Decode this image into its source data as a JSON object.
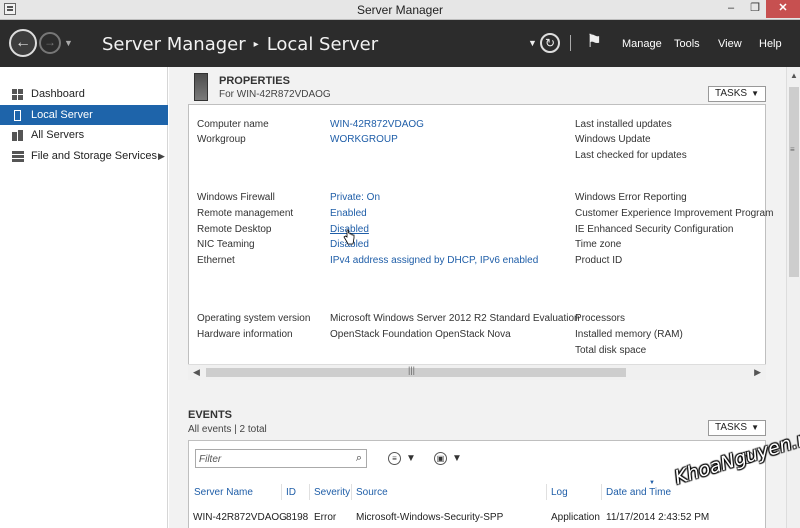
{
  "window": {
    "title": "Server Manager",
    "minimize": "–",
    "maximize": "❐",
    "close": "✕"
  },
  "header": {
    "breadcrumb_root": "Server Manager",
    "breadcrumb_sep": "▸",
    "breadcrumb_current": "Local Server",
    "back_icon": "back-arrow-icon",
    "menus": [
      "Manage",
      "Tools",
      "View",
      "Help"
    ]
  },
  "sidebar": {
    "items": [
      {
        "label": "Dashboard",
        "icon": "dashboard-icon",
        "active": false
      },
      {
        "label": "Local Server",
        "icon": "local-server-icon",
        "active": true
      },
      {
        "label": "All Servers",
        "icon": "all-servers-icon",
        "active": false
      },
      {
        "label": "File and Storage Services",
        "icon": "storage-icon",
        "active": false,
        "has_arrow": true
      }
    ]
  },
  "properties": {
    "title": "PROPERTIES",
    "subtitle": "For WIN-42R872VDAOG",
    "tasks_label": "TASKS",
    "left": [
      {
        "key": "Computer name",
        "value": "WIN-42R872VDAOG"
      },
      {
        "key": "Workgroup",
        "value": "WORKGROUP"
      },
      {
        "key": "Windows Firewall",
        "value": "Private: On"
      },
      {
        "key": "Remote management",
        "value": "Enabled"
      },
      {
        "key": "Remote Desktop",
        "value": "Disabled"
      },
      {
        "key": "NIC Teaming",
        "value": "Disabled"
      },
      {
        "key": "Ethernet",
        "value": "IPv4 address assigned by DHCP, IPv6 enabled"
      },
      {
        "key": "Operating system version",
        "value": "Microsoft Windows Server 2012 R2 Standard Evaluation"
      },
      {
        "key": "Hardware information",
        "value": "OpenStack Foundation OpenStack Nova"
      }
    ],
    "right": [
      "Last installed updates",
      "Windows Update",
      "Last checked for updates",
      "Windows Error Reporting",
      "Customer Experience Improvement Program",
      "IE Enhanced Security Configuration",
      "Time zone",
      "Product ID",
      "Processors",
      "Installed memory (RAM)",
      "Total disk space"
    ]
  },
  "events": {
    "title": "EVENTS",
    "subtitle": "All events | 2 total",
    "tasks_label": "TASKS",
    "filter_placeholder": "Filter",
    "columns": [
      "Server Name",
      "ID",
      "Severity",
      "Source",
      "Log",
      "Date and Time"
    ],
    "rows": [
      {
        "server": "WIN-42R872VDAOG",
        "id": "8198",
        "severity": "Error",
        "source": "Microsoft-Windows-Security-SPP",
        "log": "Application",
        "date": "11/17/2014 2:43:52 PM"
      }
    ]
  },
  "watermark": "KhoaNguyen.me",
  "colors": {
    "header_bg": "#2c2c2c",
    "active_nav": "#1e64aa",
    "link": "#1f5ea8",
    "close_btn": "#c75050"
  }
}
